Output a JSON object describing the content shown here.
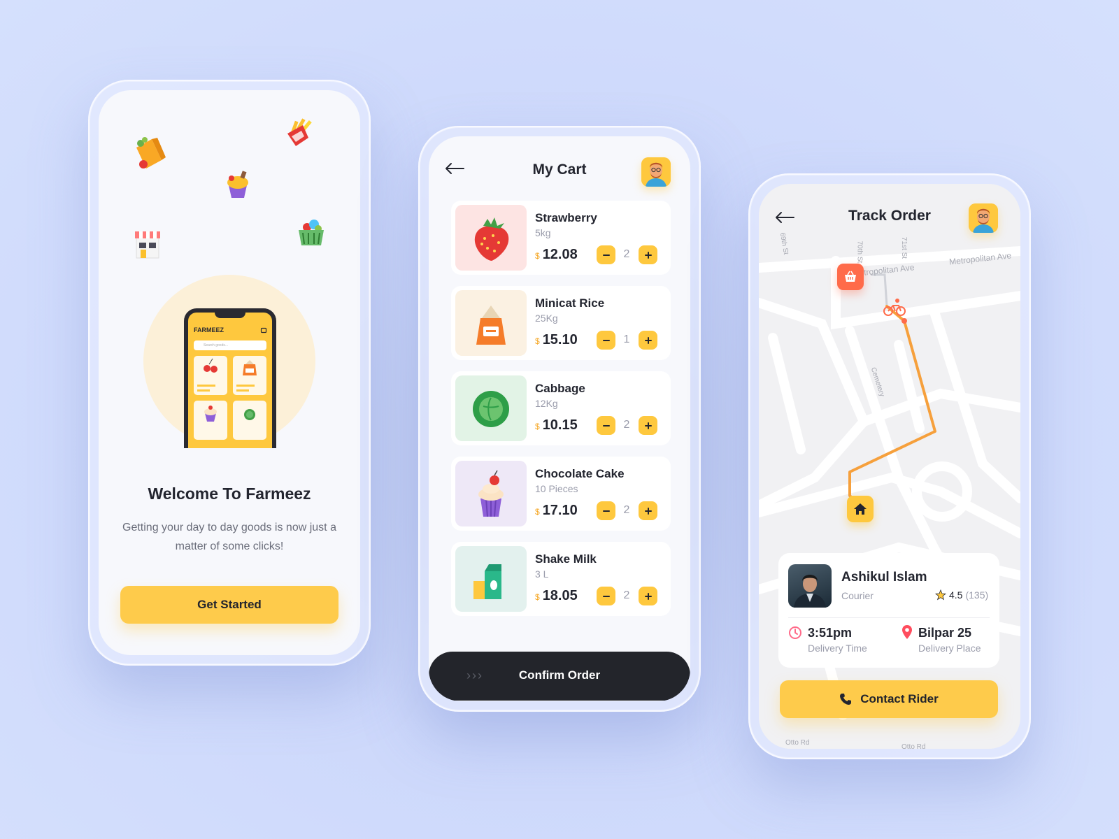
{
  "welcome": {
    "hero_brand": "FARMEEZ",
    "hero_search_placeholder": "Search goods...",
    "title": "Welcome To Farmeez",
    "text": "Getting your day to day goods is now just a matter of some clicks!",
    "button": "Get Started",
    "icons": [
      "grocery-bag-icon",
      "fries-icon",
      "cupcake-icon",
      "store-icon",
      "basket-icon"
    ]
  },
  "cart": {
    "title": "My Cart",
    "currency": "$",
    "items": [
      {
        "name": "Strawberry",
        "unit": "5kg",
        "price": "12.08",
        "qty": "2",
        "icon": "strawberry-icon",
        "bg": "#fde4e3"
      },
      {
        "name": "Minicat Rice",
        "unit": "25Kg",
        "price": "15.10",
        "qty": "1",
        "icon": "rice-sack-icon",
        "bg": "#fbf1e2"
      },
      {
        "name": "Cabbage",
        "unit": "12Kg",
        "price": "10.15",
        "qty": "2",
        "icon": "cabbage-icon",
        "bg": "#e2f3e6"
      },
      {
        "name": "Chocolate Cake",
        "unit": "10 Pieces",
        "price": "17.10",
        "qty": "2",
        "icon": "cupcake-icon",
        "bg": "#eee8f7"
      },
      {
        "name": "Shake Milk",
        "unit": "3 L",
        "price": "18.05",
        "qty": "2",
        "icon": "milk-carton-icon",
        "bg": "#e3f1ee"
      }
    ],
    "confirm_arrows": "›››",
    "confirm_label": "Confirm Order"
  },
  "track": {
    "title": "Track Order",
    "streets": {
      "s69": "69th St",
      "s70": "70th St",
      "s71": "71st St",
      "metro1": "tropolitan Ave",
      "metro2": "Metropolitan Ave",
      "cemetery": "Cemetery",
      "otto1": "Otto Rd",
      "otto2": "Otto Rd"
    },
    "courier": {
      "name": "Ashikul Islam",
      "role": "Courier",
      "rating": "4.5",
      "rating_count": "(135)"
    },
    "delivery_time": "3:51pm",
    "delivery_time_label": "Delivery Time",
    "delivery_place": "Bilpar 25",
    "delivery_place_label": "Delivery Place",
    "button": "Contact Rider"
  },
  "colors": {
    "accent": "#fec83e",
    "dark": "#23252b",
    "route": "#f6a03c",
    "pin_red": "#ff6b4a"
  }
}
